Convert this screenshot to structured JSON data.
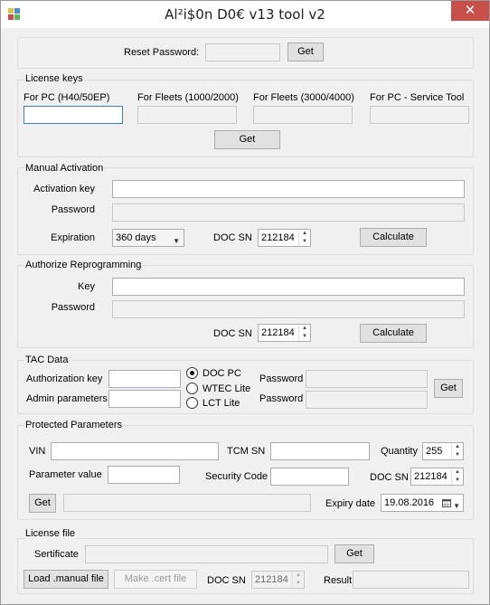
{
  "window": {
    "title": "Al²i$0n D0€ v13 tool v2",
    "close_glyph": "✕",
    "icon": "app-icon"
  },
  "reset": {
    "label": "Reset Password:",
    "value": "",
    "get": "Get"
  },
  "license_keys": {
    "legend": "License keys",
    "col1": "For PC (H40/50EP)",
    "col2": "For Fleets (1000/2000)",
    "col3": "For Fleets (3000/4000)",
    "col4": "For PC - Service Tool",
    "get": "Get"
  },
  "manual": {
    "legend": "Manual Activation",
    "activation_key": "Activation key",
    "password": "Password",
    "expiration": "Expiration",
    "expiration_value": "360 days",
    "doc_sn": "DOC SN",
    "doc_sn_value": "212184",
    "calculate": "Calculate"
  },
  "authorize": {
    "legend": "Authorize Reprogramming",
    "key": "Key",
    "password": "Password",
    "doc_sn": "DOC SN",
    "doc_sn_value": "212184",
    "calculate": "Calculate"
  },
  "tac": {
    "legend": "TAC Data",
    "auth_key": "Authorization key",
    "admin_params": "Admin parameters",
    "radio1": "DOC PC",
    "radio2": "WTEC Lite",
    "radio3": "LCT Lite",
    "password1": "Password",
    "password2": "Password",
    "get": "Get"
  },
  "protected": {
    "legend": "Protected Parameters",
    "vin": "VIN",
    "tcm_sn": "TCM SN",
    "quantity": "Quantity",
    "quantity_value": "255",
    "param_value": "Parameter value",
    "security_code": "Security Code",
    "doc_sn": "DOC SN",
    "doc_sn_value": "212184",
    "get": "Get",
    "expiry": "Expiry date",
    "expiry_value": "19.08.2016"
  },
  "license_file": {
    "legend": "License file",
    "sertificate": "Sertificate",
    "get": "Get",
    "load": "Load .manual file",
    "make": "Make .cert file",
    "doc_sn": "DOC SN",
    "doc_sn_value": "212184",
    "result": "Result"
  }
}
